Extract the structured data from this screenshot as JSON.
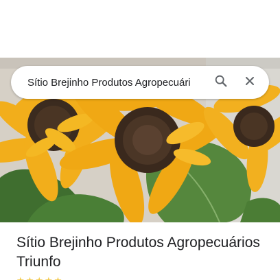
{
  "search": {
    "query": "Sítio Brejinho Produtos Agropecuári"
  },
  "place": {
    "title": "Sítio Brejinho Produtos Agropecuários Triunfo"
  },
  "icons": {
    "search": "search-icon",
    "close": "close-icon"
  },
  "colors": {
    "text_primary": "#202124",
    "icon_gray": "#5f6368",
    "petal_yellow": "#f4b400",
    "leaf_green": "#4f7f3a"
  }
}
